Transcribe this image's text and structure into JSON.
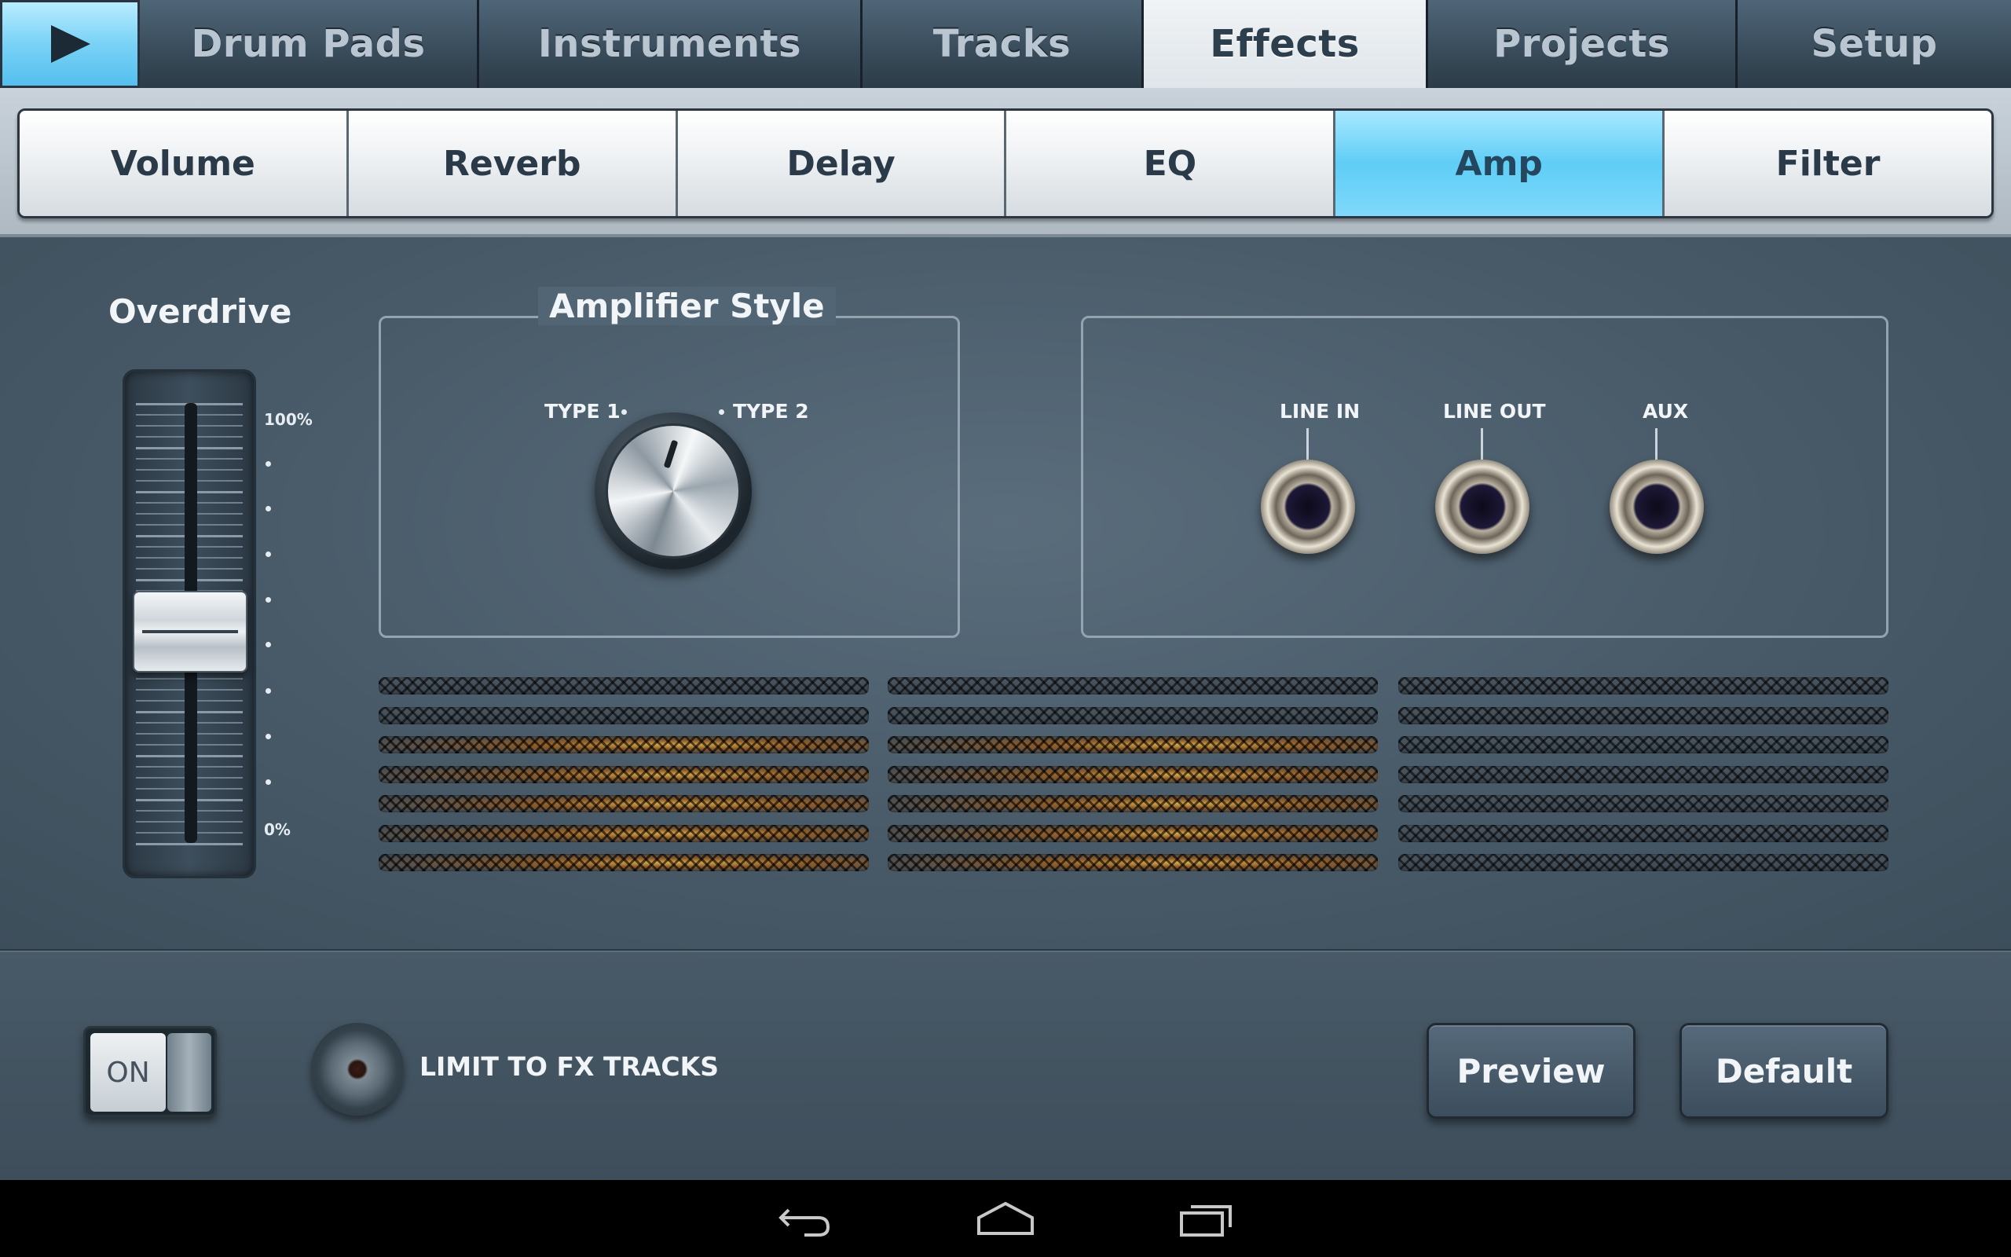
{
  "top_tabs": [
    {
      "label": ""
    },
    {
      "label": "Drum Pads"
    },
    {
      "label": "Instruments"
    },
    {
      "label": "Tracks"
    },
    {
      "label": "Effects"
    },
    {
      "label": "Projects"
    },
    {
      "label": "Setup"
    }
  ],
  "sub_tabs": [
    {
      "label": "Volume"
    },
    {
      "label": "Reverb"
    },
    {
      "label": "Delay"
    },
    {
      "label": "EQ"
    },
    {
      "label": "Amp"
    },
    {
      "label": "Filter"
    }
  ],
  "overdrive": {
    "title": "Overdrive",
    "max_label": "100%",
    "min_label": "0%",
    "value_fraction": 0.48
  },
  "amplifier_style": {
    "title": "Amplifier Style",
    "type1": "TYPE 1",
    "type2": "TYPE 2"
  },
  "io": {
    "line_in": "LINE IN",
    "line_out": "LINE OUT",
    "aux": "AUX"
  },
  "bottom": {
    "toggle_label": "ON",
    "limit_label": "LIMIT TO FX TRACKS",
    "preview_label": "Preview",
    "default_label": "Default"
  },
  "colors": {
    "accent": "#5fcdf6",
    "panel": "#485a68"
  }
}
